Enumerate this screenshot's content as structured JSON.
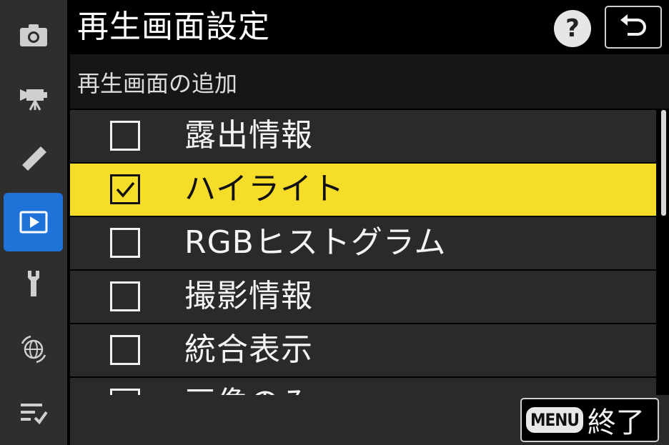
{
  "header": {
    "title": "再生画面設定",
    "help_icon": "?",
    "back_icon": "return-icon"
  },
  "section": {
    "title": "再生画面の追加"
  },
  "options": [
    {
      "label": "露出情報",
      "checked": false,
      "selected": false
    },
    {
      "label": "ハイライト",
      "checked": true,
      "selected": true
    },
    {
      "label": "RGBヒストグラム",
      "checked": false,
      "selected": false
    },
    {
      "label": "撮影情報",
      "checked": false,
      "selected": false
    },
    {
      "label": "統合表示",
      "checked": false,
      "selected": false
    },
    {
      "label": "画像のみ",
      "checked": false,
      "selected": false
    }
  ],
  "footer": {
    "menu_badge": "MENU",
    "exit_label": "終了"
  },
  "sidebar": {
    "items": [
      {
        "icon": "camera-icon",
        "active": false
      },
      {
        "icon": "movie-camera-icon",
        "active": false
      },
      {
        "icon": "pencil-icon",
        "active": false
      },
      {
        "icon": "playback-icon",
        "active": true
      },
      {
        "icon": "wrench-icon",
        "active": false
      },
      {
        "icon": "network-icon",
        "active": false
      },
      {
        "icon": "my-menu-icon",
        "active": false
      }
    ]
  },
  "colors": {
    "selection": "#f6dd29",
    "active_tab": "#1f72d8"
  }
}
